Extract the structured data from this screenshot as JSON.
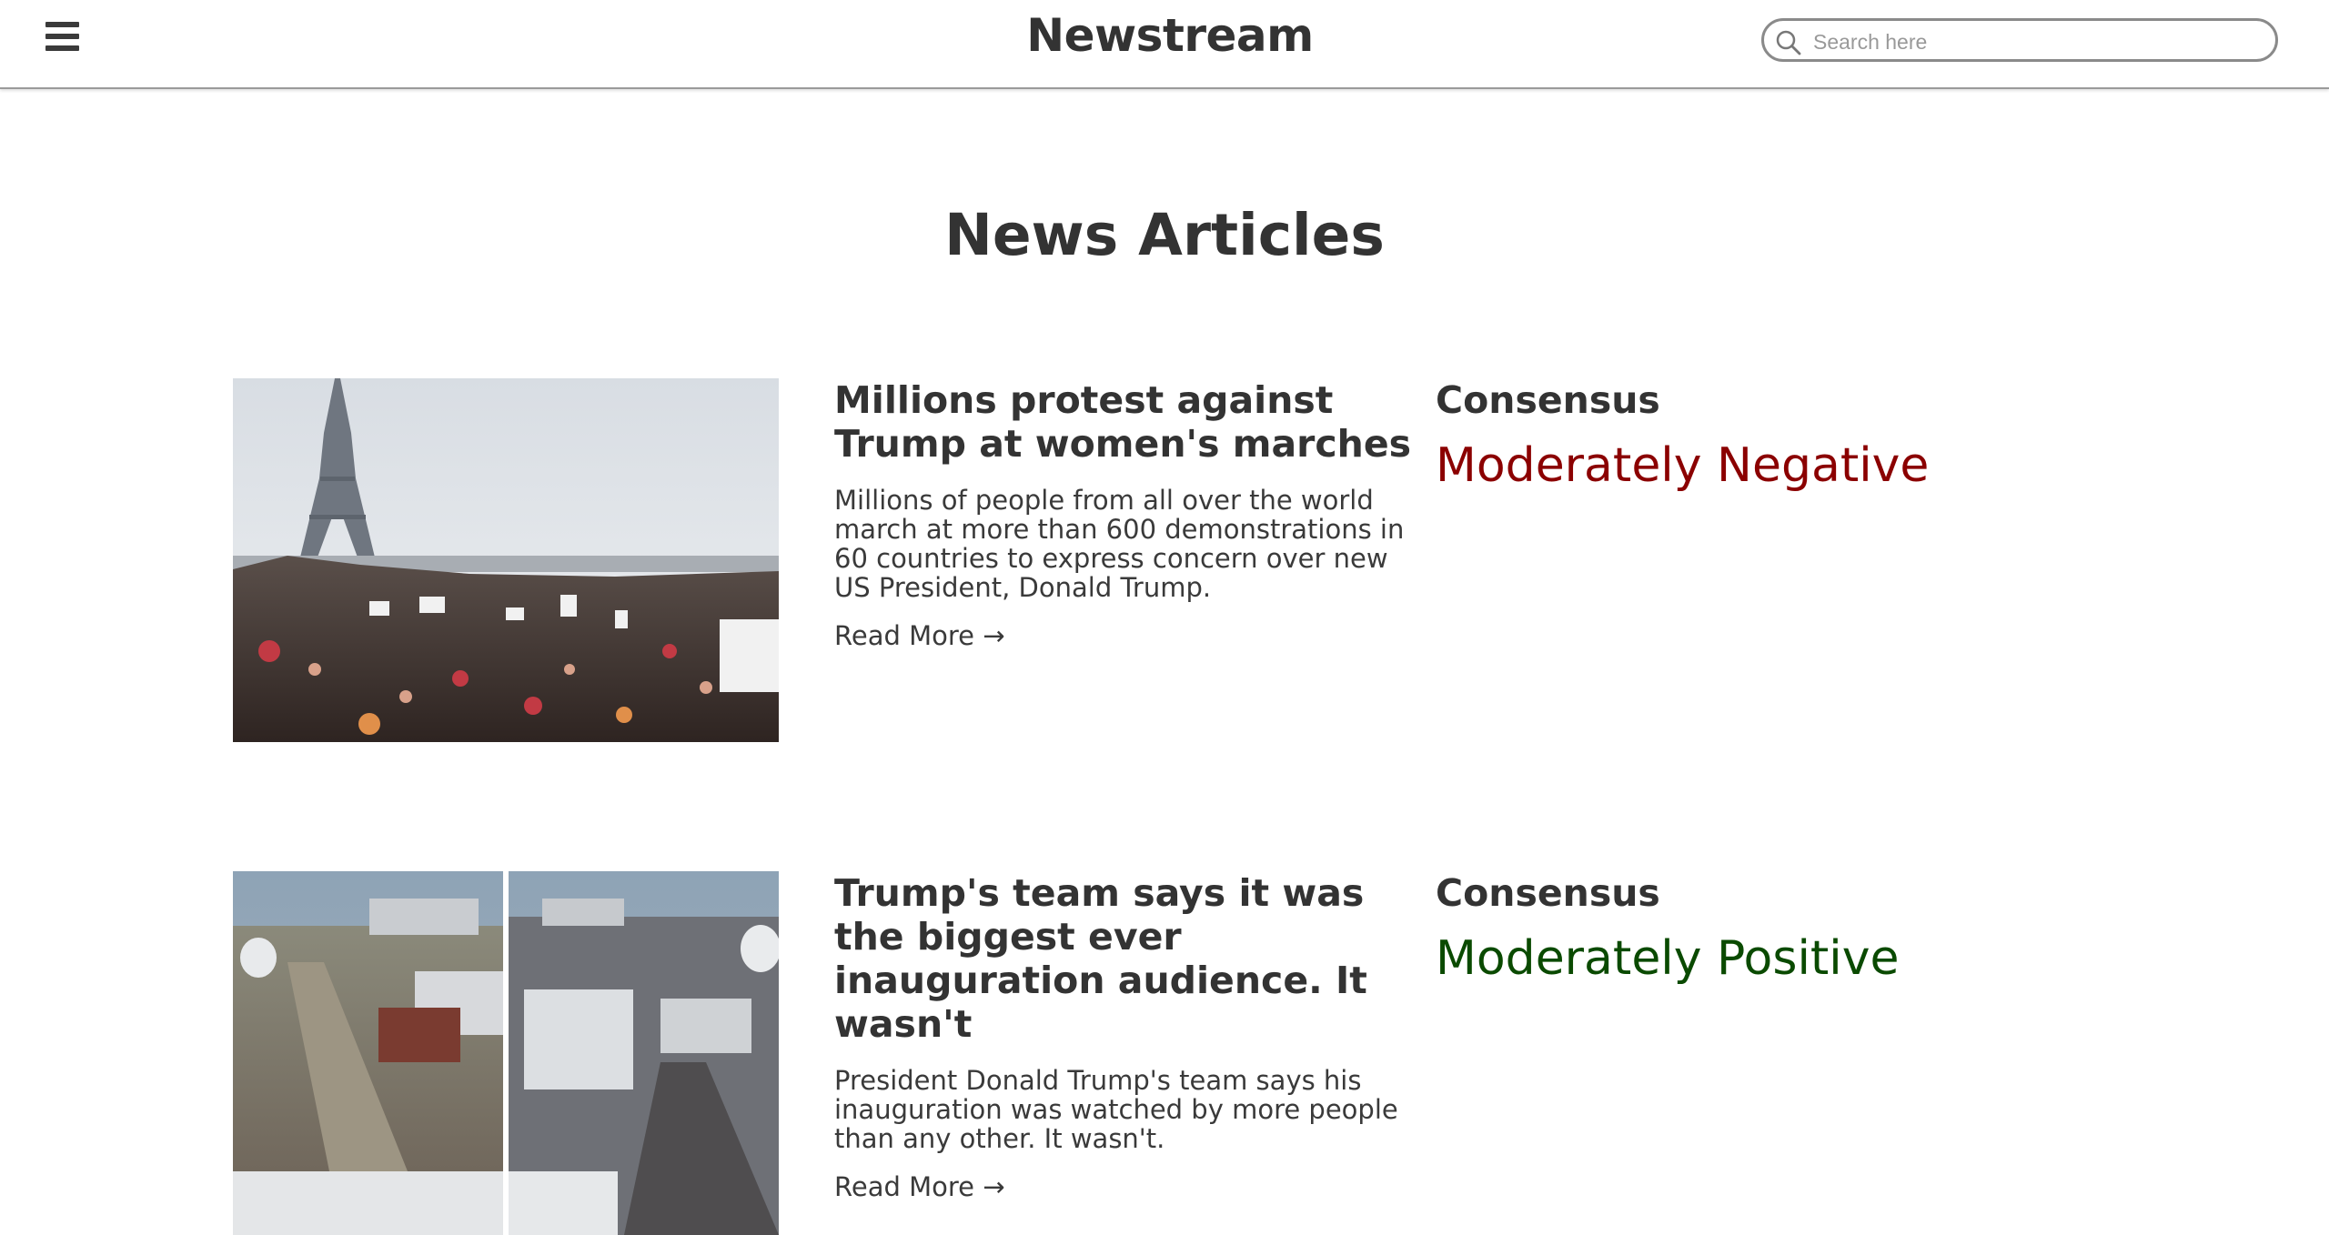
{
  "header": {
    "brand": "Newstream",
    "search_placeholder": "Search here"
  },
  "icons": {
    "menu": "hamburger-icon",
    "search": "search-icon"
  },
  "main": {
    "section_title": "News Articles",
    "articles": [
      {
        "title": "Millions protest against Trump at women's marches",
        "summary": "Millions of people from all over the world march at more than 600 demonstrations in 60 countries to express concern over new US President, Donald Trump.",
        "read_more": "Read More →",
        "consensus_label": "Consensus",
        "consensus_value": "Moderately Negative",
        "consensus_color": "#8b0000"
      },
      {
        "title": "Trump's team says it was the biggest ever inauguration audience. It wasn't",
        "summary": "President Donald Trump's team says his inauguration was watched by more people than any other. It wasn't.",
        "read_more": "Read More →",
        "consensus_label": "Consensus",
        "consensus_value": "Moderately Positive",
        "consensus_color": "#0a4a00"
      }
    ]
  },
  "colors": {
    "text": "#333333",
    "negative": "#8b0000",
    "positive": "#0a4a00",
    "nav_border": "#9a9a9a"
  }
}
